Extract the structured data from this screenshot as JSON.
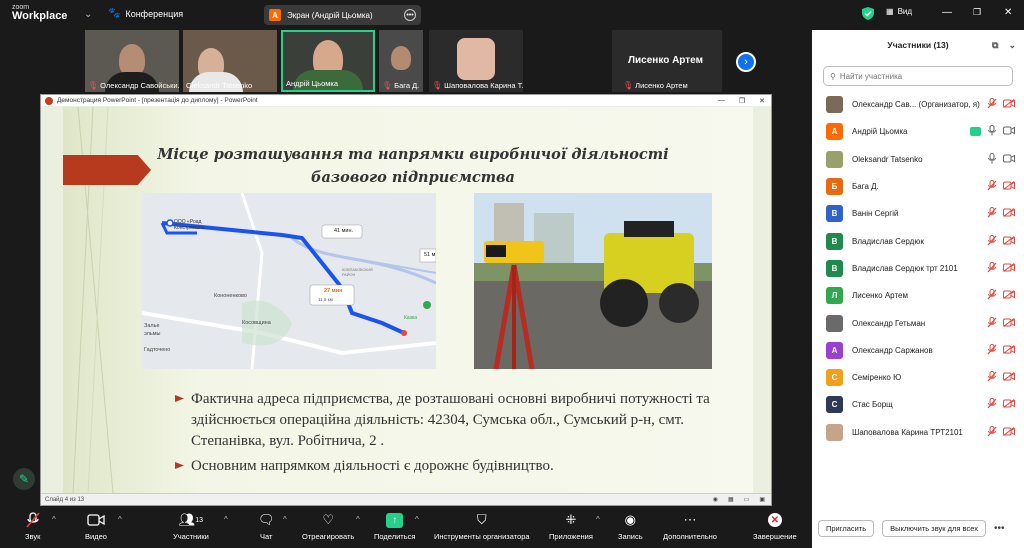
{
  "topbar": {
    "brand_small": "zoom",
    "brand_big": "Workplace",
    "conference_label": "Конференция",
    "share_pill": "Экран (Андрій Цьомка)",
    "share_avatar": "А",
    "view_label": "Вид"
  },
  "gallery": [
    {
      "name": "Олександр Савойськи...",
      "muted": true
    },
    {
      "name": "Oleksandr Tatsenko",
      "muted": false
    },
    {
      "name": "Андрій Цьомка",
      "muted": false,
      "active": true
    },
    {
      "name": "Бага Д.",
      "muted": true
    },
    {
      "name": "Шаповалова Карина Т...",
      "muted": true
    }
  ],
  "name_tile": {
    "big": "Лисенко Артем",
    "small": "Лисенко Артем"
  },
  "ppt": {
    "window_title": "Демонстрация PowerPoint - [презентація до диплому] - PowerPoint",
    "slide_title": "Місце розташування та напрямки виробничої діяльності базового підприємства",
    "bullets": [
      "Фактична адреса підприємства, де розташовані основні виробничі потужності та здійснюється операційна діяльність: 42304, Сумська обл., Сумський р-н, смт. Степанівка, вул. Робітнича, 2 .",
      "Основним напрямком діяльності є дорожнє будівництво."
    ],
    "status": "Слайд 4 из 13",
    "map_labels": {
      "l1": "ООО «Роад Констракшн»",
      "l2": "41 мин.",
      "l3": "51 м",
      "l4": "27 мин",
      "l5": "11,5 км",
      "l6": "Кононенково",
      "l7": "Косовщина",
      "l8": "Залье",
      "l9": "эльмы",
      "l10": "Гадточено",
      "l11": "Казка",
      "l12": "КОВПАКОВСКИЙ РАЙОН"
    }
  },
  "participants": {
    "title": "Участники (13)",
    "search_placeholder": "Найти участника",
    "list": [
      {
        "name": "Олександр Сав...  (Организатор, я)",
        "avatar": "",
        "color": "#7b6a58",
        "photo": true,
        "mic": "off",
        "cam": "off"
      },
      {
        "name": "Андрій Цьомка",
        "avatar": "А",
        "color": "#ff6b00",
        "photo": false,
        "mic": "on",
        "cam": "on",
        "share": true
      },
      {
        "name": "Oleksandr Tatsenko",
        "avatar": "",
        "color": "#9aa06a",
        "photo": true,
        "mic": "on",
        "cam": "on"
      },
      {
        "name": "Бага Д.",
        "avatar": "Б",
        "color": "#e86a10",
        "photo": false,
        "mic": "off",
        "cam": "off"
      },
      {
        "name": "Ванін Сергій",
        "avatar": "В",
        "color": "#2e64c8",
        "photo": false,
        "mic": "off",
        "cam": "off"
      },
      {
        "name": "Владислав Сердюк",
        "avatar": "В",
        "color": "#1f8a4c",
        "photo": false,
        "mic": "off",
        "cam": "off"
      },
      {
        "name": "Владислав Сердюк трт 2101",
        "avatar": "В",
        "color": "#1f8a4c",
        "photo": false,
        "mic": "off",
        "cam": "off"
      },
      {
        "name": "Лисенко Артем",
        "avatar": "Л",
        "color": "#2fa84f",
        "photo": false,
        "mic": "off",
        "cam": "off"
      },
      {
        "name": "Олександр Гетьман",
        "avatar": "",
        "color": "#6a6a6a",
        "photo": true,
        "mic": "off",
        "cam": "off"
      },
      {
        "name": "Олександр Саржанов",
        "avatar": "А",
        "color": "#9b3fd0",
        "photo": false,
        "mic": "off",
        "cam": "off"
      },
      {
        "name": "Семіренко Ю",
        "avatar": "С",
        "color": "#f0a01a",
        "photo": false,
        "mic": "off",
        "cam": "off"
      },
      {
        "name": "Стас Борщ",
        "avatar": "С",
        "color": "#2d3a55",
        "photo": false,
        "mic": "off",
        "cam": "off"
      },
      {
        "name": "Шаповалова Карина ТРТ2101",
        "avatar": "",
        "color": "#c4a48a",
        "photo": true,
        "mic": "off",
        "cam": "off"
      }
    ],
    "invite_label": "Пригласить",
    "mute_all_label": "Выключить звук для всех"
  },
  "toolbar": {
    "audio": "Звук",
    "video": "Видео",
    "participants": "Участники",
    "participants_count": "13",
    "chat": "Чат",
    "react": "Отреагировать",
    "share": "Поделиться",
    "host_tools": "Инструменты организатора",
    "apps": "Приложения",
    "record": "Запись",
    "more": "Дополнительно",
    "end": "Завершение"
  }
}
